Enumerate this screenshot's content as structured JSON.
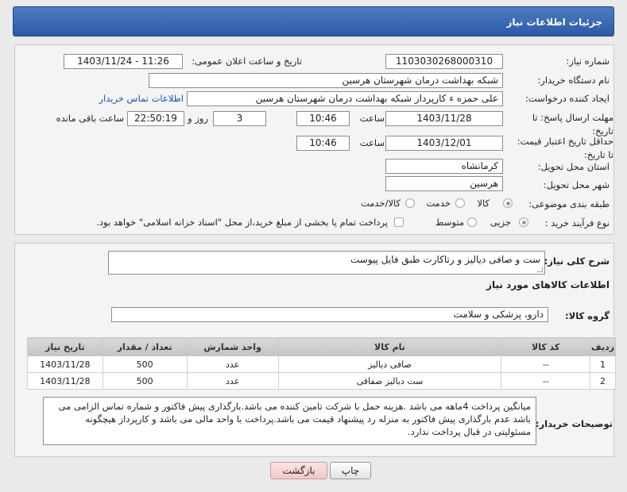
{
  "header": {
    "title": "جزئیات اطلاعات نیاز"
  },
  "form": {
    "need_number_label": "شماره نیاز:",
    "need_number": "1103030268000310",
    "announce_label": "تاریخ و ساعت اعلان عمومی:",
    "announce_value": "1403/11/24 - 11:26",
    "buyer_org_label": "نام دستگاه خریدار:",
    "buyer_org": "شبکه بهداشت درمان شهرستان هرسین",
    "requester_label": "ایجاد کننده درخواست:",
    "requester": "علی حمزه ء کارپرداز شبکه بهداشت درمان شهرستان هرسین",
    "contact_link": "اطلاعات تماس خریدار",
    "deadline_label": "مهلت ارسال پاسخ: تا تاریخ:",
    "deadline_date": "1403/11/28",
    "time_label": "ساعت",
    "deadline_time": "10:46",
    "days_value": "3",
    "days_label": "روز و",
    "remaining_time": "22:50:19",
    "remaining_label": "ساعت باقی مانده",
    "validity_label": "حداقل تاریخ اعتبار قیمت: تا تاریخ:",
    "validity_date": "1403/12/01",
    "validity_time": "10:46",
    "province_label": "استان محل تحویل:",
    "province": "کرمانشاه",
    "city_label": "شهر محل تحویل:",
    "city": "هرسین",
    "category_label": "طبقه بندی موضوعی:",
    "category_options": [
      "کالا",
      "خدمت",
      "کالا/خدمت"
    ],
    "category_selected": "کالا",
    "process_label": "نوع فرآیند خرید :",
    "process_options": [
      "جزیی",
      "متوسط"
    ],
    "process_selected": "جزیی",
    "payment_text": "پرداخت تمام یا بخشی از مبلغ خرید،از محل \"اسناد خزانه اسلامی\" خواهد بود."
  },
  "summary": {
    "description_label": "شرح کلی نیاز:",
    "description": "ست و صافی دیالیز و رتاکارت طبق فایل پیوست",
    "goods_info_title": "اطلاعات کالاهای مورد نیاز",
    "goods_group_label": "گروه کالا:",
    "goods_group": "دارو، پزشکی و سلامت"
  },
  "table": {
    "headers": [
      "ردیف",
      "کد کالا",
      "نام کالا",
      "واحد شمارش",
      "تعداد / مقدار",
      "تاریخ نیاز"
    ],
    "rows": [
      [
        "1",
        "--",
        "صافی دیالیز",
        "عدد",
        "500",
        "1403/11/28"
      ],
      [
        "2",
        "--",
        "ست دیالیز صفاقی",
        "عدد",
        "500",
        "1403/11/28"
      ]
    ]
  },
  "notes": {
    "label": "توضیحات خریدار:",
    "text": "میانگین پرداخت 4ماهه می باشد .هزینه حمل با شرکت تامین کننده می باشد.بارگذاری پیش فاکتور و شماره تماس الزامی می باشد عدم بارگذاری پیش فاکتور به منزله رد پیشنهاد قیمت می باشد.پرداخت با واحد مالی می باشد و کارپرداز هیچگونه مسئولیتی در قبال پرداخت ندارد."
  },
  "buttons": {
    "print": "چاپ",
    "back": "بازگشت"
  }
}
